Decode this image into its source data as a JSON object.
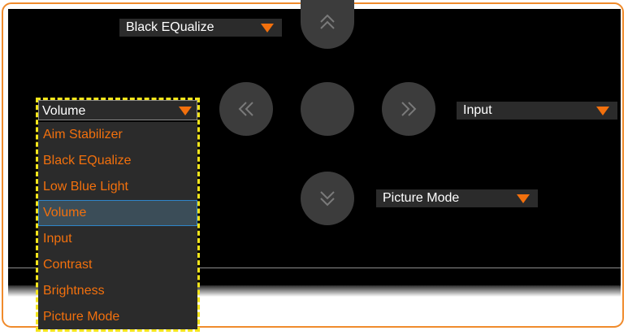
{
  "top_dropdown": {
    "value": "Black EQualize"
  },
  "right_dropdown": {
    "value": "Input"
  },
  "bottom_dropdown": {
    "value": "Picture Mode"
  },
  "left_dropdown": {
    "value": "Volume",
    "options": [
      "Aim Stabilizer",
      "Black EQualize",
      "Low Blue Light",
      "Volume",
      "Input",
      "Contrast",
      "Brightness",
      "Picture Mode"
    ],
    "selected_option": "Volume"
  },
  "colors": {
    "accent": "#f2700d",
    "frame": "#f08b2c",
    "highlight": "#f4e51b",
    "selection": "#3b4d58"
  },
  "icons": {
    "up": "double-chevron-up-icon",
    "down": "double-chevron-down-icon",
    "left": "double-chevron-left-icon",
    "right": "double-chevron-right-icon"
  }
}
